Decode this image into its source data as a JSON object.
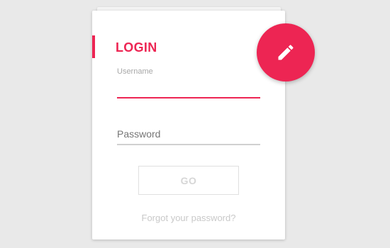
{
  "login": {
    "title": "LOGIN",
    "username": {
      "label": "Username",
      "value": ""
    },
    "password": {
      "placeholder": "Password",
      "value": ""
    },
    "go_label": "GO",
    "forgot_label": "Forgot your password?"
  },
  "fab": {
    "icon": "pencil-icon"
  },
  "colors": {
    "accent": "#ed2553",
    "background": "#e9e9e9",
    "card": "#ffffff",
    "muted_text": "#c9c9c9"
  }
}
